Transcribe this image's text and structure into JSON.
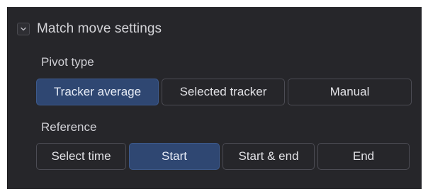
{
  "section": {
    "title": "Match move settings",
    "expanded": true,
    "toggle_icon": "chevron-down-icon"
  },
  "pivot_type": {
    "label": "Pivot type",
    "options": [
      "Tracker average",
      "Selected tracker",
      "Manual"
    ],
    "selected": "Tracker average"
  },
  "reference": {
    "label": "Reference",
    "options": [
      "Select time",
      "Start",
      "Start & end",
      "End"
    ],
    "selected": "Start"
  },
  "colors": {
    "panel_bg": "#26262a",
    "active_button": "#2f4772",
    "button_border": "#4c4c54",
    "text": "#d4d4d8"
  }
}
